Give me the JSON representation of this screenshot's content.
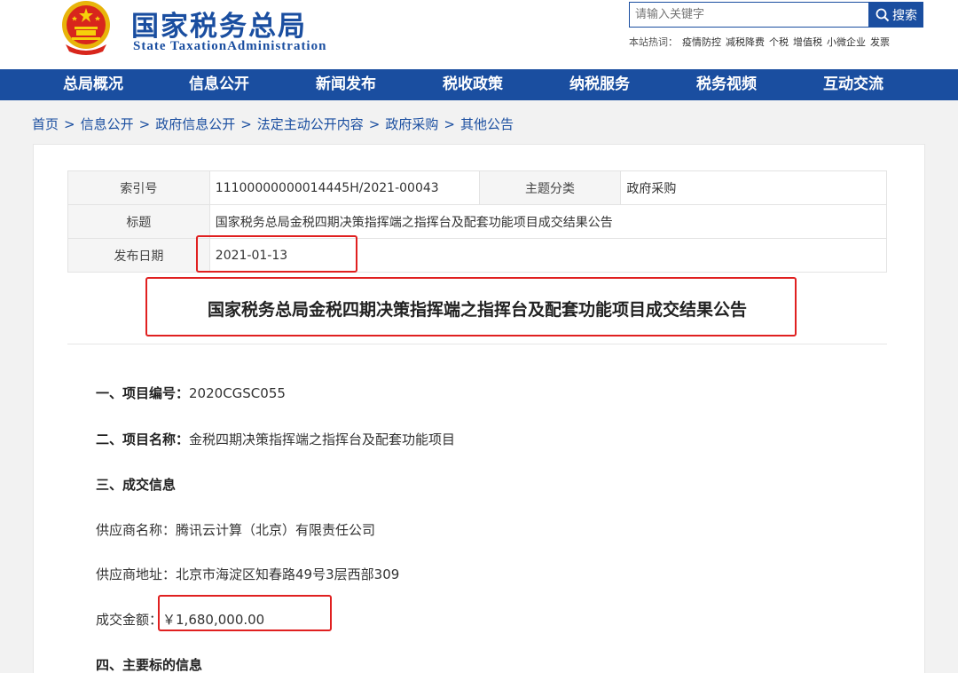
{
  "header": {
    "title": "国家税务总局",
    "subtitle": "State TaxationAdministration",
    "search_placeholder": "请输入关键字",
    "search_button": "搜索",
    "hot_label": "本站热词：",
    "hot_words": [
      "疫情防控",
      "减税降费",
      "个税",
      "增值税",
      "小微企业",
      "发票"
    ]
  },
  "nav": [
    "总局概况",
    "信息公开",
    "新闻发布",
    "税收政策",
    "纳税服务",
    "税务视频",
    "互动交流"
  ],
  "breadcrumb": [
    "首页",
    "信息公开",
    "政府信息公开",
    "法定主动公开内容",
    "政府采购",
    "其他公告"
  ],
  "breadcrumb_sep": ">",
  "meta": {
    "index_label": "索引号",
    "index_value": "11100000000014445H/2021-00043",
    "category_label": "主题分类",
    "category_value": "政府采购",
    "title_label": "标题",
    "title_value": "国家税务总局金税四期决策指挥端之指挥台及配套功能项目成交结果公告",
    "date_label": "发布日期",
    "date_value": "2021-01-13"
  },
  "doc": {
    "title": "国家税务总局金税四期决策指挥端之指挥台及配套功能项目成交结果公告",
    "s1_label": "一、项目编号：",
    "s1_value": "2020CGSC055",
    "s2_label": "二、项目名称：",
    "s2_value": "金税四期决策指挥端之指挥台及配套功能项目",
    "s3_label": "三、成交信息",
    "supplier_name_label": "供应商名称：",
    "supplier_name_value": "腾讯云计算（北京）有限责任公司",
    "supplier_addr_label": "供应商地址：",
    "supplier_addr_value": "北京市海淀区知春路49号3层西部309",
    "amount_label": "成交金额：",
    "amount_value": "￥1,680,000.00",
    "s4_label": "四、主要标的信息"
  },
  "colors": {
    "brand": "#1a4ea0",
    "highlight": "#e02020"
  }
}
